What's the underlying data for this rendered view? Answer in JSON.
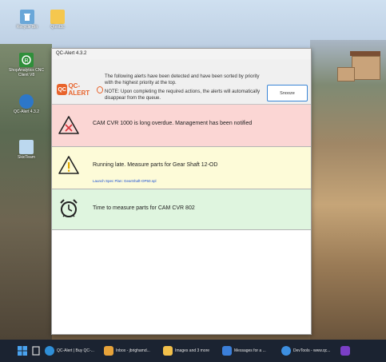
{
  "desktop": {
    "icons": [
      {
        "label": "Recycle Bin",
        "icon": "recycle-bin-icon",
        "color": "#6aa7d8"
      },
      {
        "label": "Qtest2c",
        "icon": "folder-icon",
        "color": "#f5c74e"
      },
      {
        "label": "ShopAnalytics CNC Client V8",
        "icon": "analytics-app-icon",
        "color": "#2f8f3a"
      },
      {
        "label": "QC-Alert 4.3.2",
        "icon": "qc-alert-app-icon",
        "color": "#2d77c8"
      },
      {
        "label": "SkidTeam",
        "icon": "skidteam-app-icon",
        "color": "#bcd8ef"
      }
    ]
  },
  "window": {
    "title": "QC-Alert 4.3.2",
    "logo_text": "QC-ALERT",
    "intro_line1": "The following alerts have been detected and have been sorted by priority with the highest priority at the top.",
    "intro_line2": "NOTE: Upon completing the required actions, the alerts will automatically disappear from the queue.",
    "snooze_label": "Snooze"
  },
  "alerts": [
    {
      "icon": "warning-error-icon",
      "message": "CAM CVR 1000 is long overdue. Management has been notified",
      "color": "#fbd6d4"
    },
    {
      "icon": "warning-icon",
      "message": "Running late. Measure parts for Gear Shaft 12-OD",
      "link": "Launch Spec Plan: GearShaft-OP50.spl",
      "color": "#fdfbd8"
    },
    {
      "icon": "alarm-clock-icon",
      "message": "Time to measure parts for CAM CVR 802",
      "color": "#dff5df"
    }
  ],
  "taskbar": {
    "items": [
      {
        "label": "",
        "icon": "windows-start-icon"
      },
      {
        "label": "",
        "icon": "task-view-icon"
      },
      {
        "label": "QC-Alert | Buy QC-...",
        "icon": "edge-browser-icon"
      },
      {
        "label": "Inbox - jbrighamd...",
        "icon": "outlook-icon"
      },
      {
        "label": "Images and 3 more",
        "icon": "file-explorer-icon"
      },
      {
        "label": "Messages for a ...",
        "icon": "messages-icon"
      },
      {
        "label": "DevTools - www.qc...",
        "icon": "chrome-devtools-icon"
      },
      {
        "label": "",
        "icon": "onenote-icon"
      }
    ]
  }
}
